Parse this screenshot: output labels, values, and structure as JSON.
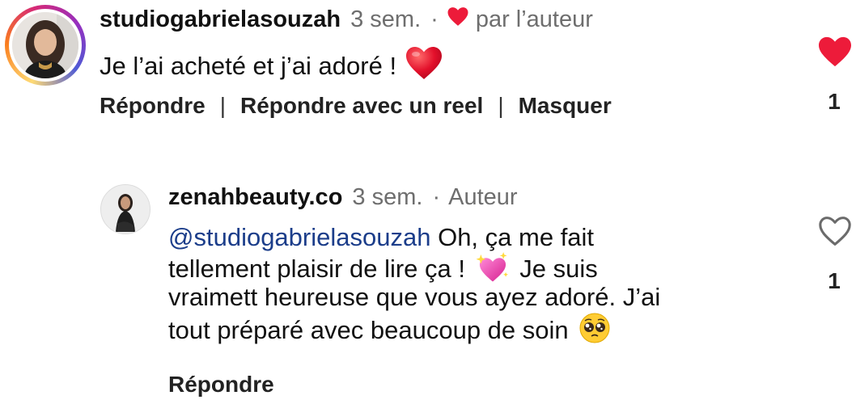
{
  "comments": [
    {
      "username": "studiogabrielasouzah",
      "time": "3 sem.",
      "dot": "·",
      "liked_by_label": "par l’auteur",
      "text": "Je l’ai acheté et j’ai adoré !",
      "actions": {
        "reply": "Répondre",
        "reply_reel": "Répondre avec un reel",
        "hide": "Masquer",
        "separator": "|"
      },
      "likes": "1",
      "liked": true,
      "emoji": "red-heart-emoji"
    },
    {
      "username": "zenahbeauty.co",
      "time": "3 sem.",
      "dot": "·",
      "author_label": "Auteur",
      "mention": "@studiogabrielasouzah",
      "text_line1": " Oh, ça me fait",
      "text_line2a": "tellement plaisir de lire ça !",
      "text_line2b": " Je suis",
      "text_line3": "vraimett heureuse que vous ayez adoré. J’ai",
      "text_line4": "tout préparé avec beaucoup de soin",
      "actions": {
        "reply": "Répondre"
      },
      "likes": "1",
      "liked": false,
      "emojis": [
        "sparkling-heart-emoji",
        "pleading-face-emoji"
      ]
    }
  ],
  "colors": {
    "like_red": "#ed1b3a",
    "mention_blue": "#1b3d8a",
    "meta_gray": "#6e6e6e"
  }
}
